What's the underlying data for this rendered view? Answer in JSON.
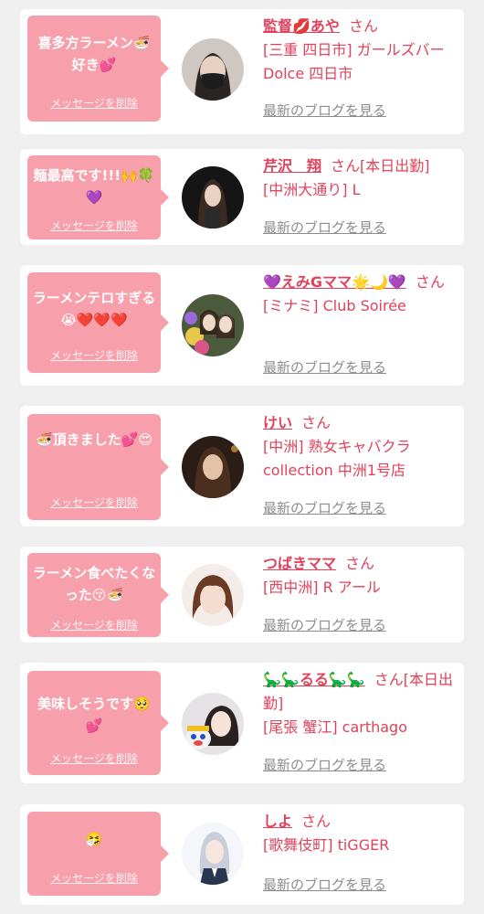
{
  "theme": {
    "accent": "#e2415b",
    "bubble": "#f89fac",
    "background": "#efefef",
    "card": "#ffffff",
    "link_gray": "#8d8d8d"
  },
  "delete_label": "メッセージを削除",
  "blog_label": "最新のブログを見る",
  "san_label": "さん",
  "entries": [
    {
      "message": "喜多方ラーメン🍜好き💕",
      "name": "監督💋あや",
      "name_suffix": "",
      "shop": "[三重 四日市] ガールズバー Dolce 四日市",
      "avatar": "avatar-woman-masked"
    },
    {
      "message": "麺最高です!!!🙌🍀💜",
      "name": "芹沢　翔",
      "name_suffix": "[本日出勤]",
      "shop": "[中洲大通り] L",
      "avatar": "avatar-woman-dark"
    },
    {
      "message": "ラーメンテロすぎる😭❤️❤️❤️",
      "name": "💜えみGママ🌟🌙💜",
      "name_suffix": "",
      "shop": "[ミナミ] Club Soirée",
      "avatar": "avatar-two-women-flowers"
    },
    {
      "message": "🍜頂きました💕😍",
      "name": "けい",
      "name_suffix": "",
      "shop": "[中洲] 熟女キャバクラ collection 中洲1号店",
      "avatar": "avatar-woman-night"
    },
    {
      "message": "ラーメン食べたくなった😚🍜",
      "name": "つばきママ",
      "name_suffix": "",
      "shop": "[西中洲] R アール",
      "avatar": "avatar-woman-light"
    },
    {
      "message": "美味しそうです🥺💕",
      "name": "🦕🦕るる🦕🦕",
      "name_suffix": "[本日出勤]",
      "shop": "[尾張 蟹江] carthago",
      "avatar": "avatar-woman-mascot"
    },
    {
      "message": "🤧",
      "name": "しよ",
      "name_suffix": "",
      "shop": "[歌舞伎町] tiGGER",
      "avatar": "avatar-silver-hair"
    }
  ]
}
